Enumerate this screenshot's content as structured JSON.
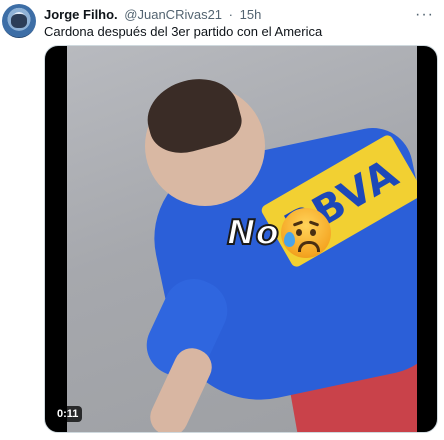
{
  "tweet": {
    "author_name": "Jorge Filho.",
    "author_handle": "@JuanCRivas21",
    "separator": "·",
    "time_ago": "15h",
    "more_icon": "···",
    "text": "Cardona después del 3er partido con el America"
  },
  "media": {
    "overlay_text": "No",
    "overlay_emoji": "anxious-face-with-sweat-icon",
    "shirt_logo_text": "BBVA",
    "video_time": "0:11"
  }
}
